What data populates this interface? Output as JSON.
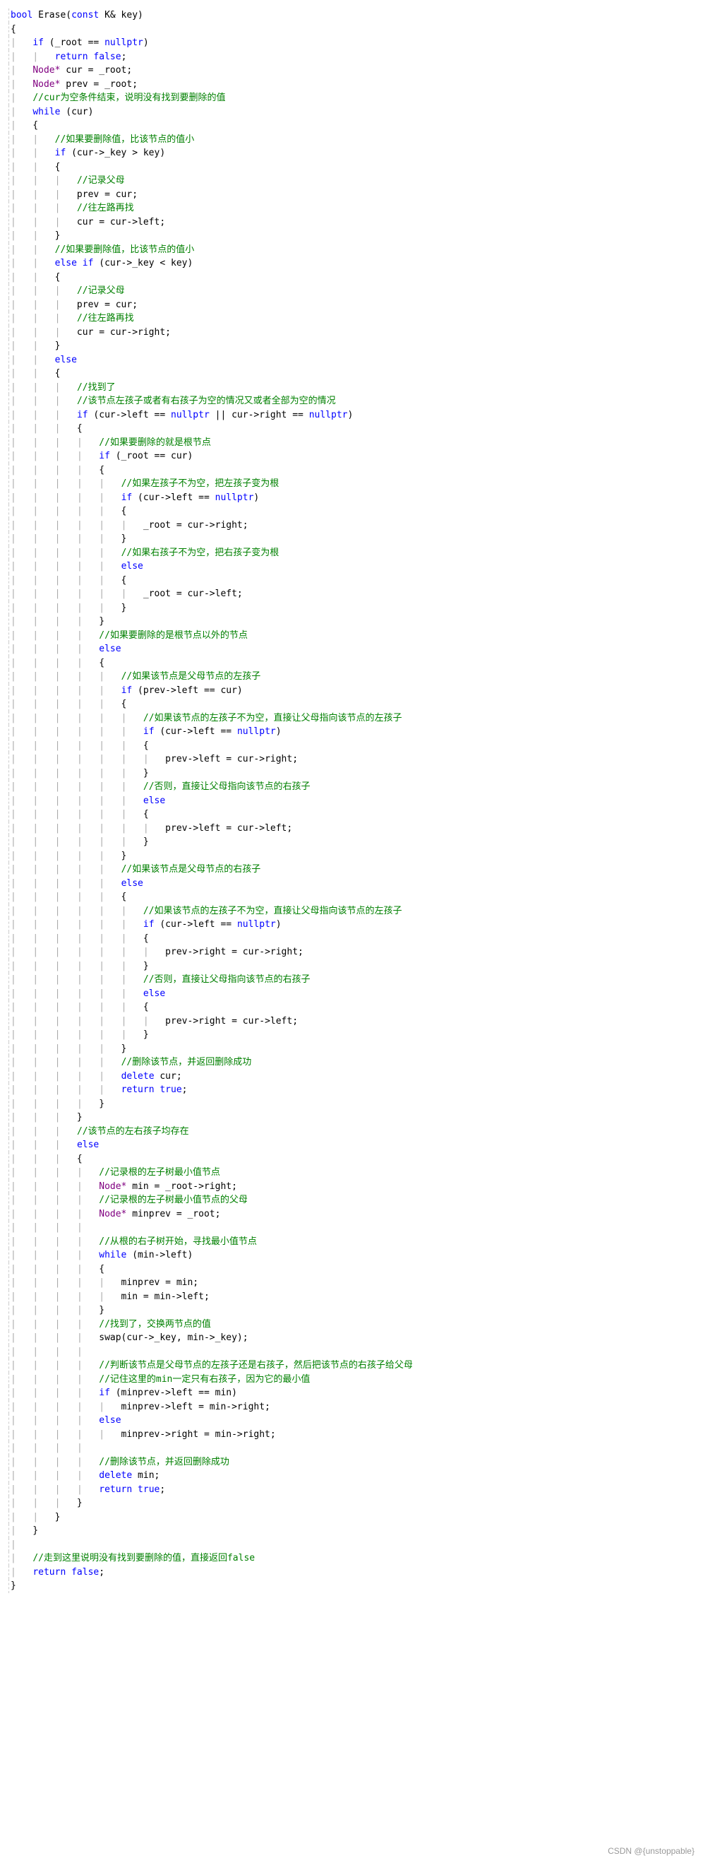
{
  "code": {
    "lines": [
      {
        "i": 0,
        "html": "<span class='k-type'>bool</span> Erase(<span class='k-type'>const</span> K& key)"
      },
      {
        "i": 0,
        "html": "{"
      },
      {
        "i": 1,
        "html": "<span class='k-key'>if</span> (_root == <span class='k-lit'>nullptr</span>)"
      },
      {
        "i": 2,
        "html": "<span class='k-key'>return</span> <span class='k-lit'>false</span>;"
      },
      {
        "i": 1,
        "html": "<span class='ptr'>Node*</span> cur = _root;"
      },
      {
        "i": 1,
        "html": "<span class='ptr'>Node*</span> prev = _root;"
      },
      {
        "i": 1,
        "html": "<span class='com'>//cur为空条件结束，说明没有找到要删除的值</span>"
      },
      {
        "i": 1,
        "html": "<span class='k-key'>while</span> (cur)"
      },
      {
        "i": 1,
        "html": "{"
      },
      {
        "i": 2,
        "html": "<span class='com'>//如果要删除值，比该节点的值小</span>"
      },
      {
        "i": 2,
        "html": "<span class='k-key'>if</span> (cur-&gt;_key &gt; key)"
      },
      {
        "i": 2,
        "html": "{"
      },
      {
        "i": 3,
        "html": "<span class='com'>//记录父母</span>"
      },
      {
        "i": 3,
        "html": "prev = cur;"
      },
      {
        "i": 3,
        "html": "<span class='com'>//往左路再找</span>"
      },
      {
        "i": 3,
        "html": "cur = cur-&gt;left;"
      },
      {
        "i": 2,
        "html": "}"
      },
      {
        "i": 2,
        "html": "<span class='com'>//如果要删除值，比该节点的值小</span>"
      },
      {
        "i": 2,
        "html": "<span class='k-key'>else</span> <span class='k-key'>if</span> (cur-&gt;_key &lt; key)"
      },
      {
        "i": 2,
        "html": "{"
      },
      {
        "i": 3,
        "html": "<span class='com'>//记录父母</span>"
      },
      {
        "i": 3,
        "html": "prev = cur;"
      },
      {
        "i": 3,
        "html": "<span class='com'>//往左路再找</span>"
      },
      {
        "i": 3,
        "html": "cur = cur-&gt;right;"
      },
      {
        "i": 2,
        "html": "}"
      },
      {
        "i": 2,
        "html": "<span class='k-key'>else</span>"
      },
      {
        "i": 2,
        "html": "{"
      },
      {
        "i": 3,
        "html": "<span class='com'>//找到了</span>"
      },
      {
        "i": 3,
        "html": "<span class='com'>//该节点左孩子或者有右孩子为空的情况又或者全部为空的情况</span>"
      },
      {
        "i": 3,
        "html": "<span class='k-key'>if</span> (cur-&gt;left == <span class='k-lit'>nullptr</span> || cur-&gt;right == <span class='k-lit'>nullptr</span>)"
      },
      {
        "i": 3,
        "html": "{"
      },
      {
        "i": 4,
        "html": "<span class='com'>//如果要删除的就是根节点</span>"
      },
      {
        "i": 4,
        "html": "<span class='k-key'>if</span> (_root == cur)"
      },
      {
        "i": 4,
        "html": "{"
      },
      {
        "i": 5,
        "html": "<span class='com'>//如果左孩子不为空，把左孩子变为根</span>"
      },
      {
        "i": 5,
        "html": "<span class='k-key'>if</span> (cur-&gt;left == <span class='k-lit'>nullptr</span>)"
      },
      {
        "i": 5,
        "html": "{"
      },
      {
        "i": 6,
        "html": "_root = cur-&gt;right;"
      },
      {
        "i": 5,
        "html": "}"
      },
      {
        "i": 5,
        "html": "<span class='com'>//如果右孩子不为空，把右孩子变为根</span>"
      },
      {
        "i": 5,
        "html": "<span class='k-key'>else</span>"
      },
      {
        "i": 5,
        "html": "{"
      },
      {
        "i": 6,
        "html": "_root = cur-&gt;left;"
      },
      {
        "i": 5,
        "html": "}"
      },
      {
        "i": 4,
        "html": "}"
      },
      {
        "i": 4,
        "html": "<span class='com'>//如果要删除的是根节点以外的节点</span>"
      },
      {
        "i": 4,
        "html": "<span class='k-key'>else</span>"
      },
      {
        "i": 4,
        "html": "{"
      },
      {
        "i": 5,
        "html": "<span class='com'>//如果该节点是父母节点的左孩子</span>"
      },
      {
        "i": 5,
        "html": "<span class='k-key'>if</span> (prev-&gt;left == cur)"
      },
      {
        "i": 5,
        "html": "{"
      },
      {
        "i": 6,
        "html": "<span class='com'>//如果该节点的左孩子不为空，直接让父母指向该节点的左孩子</span>"
      },
      {
        "i": 6,
        "html": "<span class='k-key'>if</span> (cur-&gt;left == <span class='k-lit'>nullptr</span>)"
      },
      {
        "i": 6,
        "html": "{"
      },
      {
        "i": 7,
        "html": "prev-&gt;left = cur-&gt;right;"
      },
      {
        "i": 6,
        "html": "}"
      },
      {
        "i": 6,
        "html": "<span class='com'>//否则，直接让父母指向该节点的右孩子</span>"
      },
      {
        "i": 6,
        "html": "<span class='k-key'>else</span>"
      },
      {
        "i": 6,
        "html": "{"
      },
      {
        "i": 7,
        "html": "prev-&gt;left = cur-&gt;left;"
      },
      {
        "i": 6,
        "html": "}"
      },
      {
        "i": 5,
        "html": "}"
      },
      {
        "i": 5,
        "html": "<span class='com'>//如果该节点是父母节点的右孩子</span>"
      },
      {
        "i": 5,
        "html": "<span class='k-key'>else</span>"
      },
      {
        "i": 5,
        "html": "{"
      },
      {
        "i": 6,
        "html": "<span class='com'>//如果该节点的左孩子不为空，直接让父母指向该节点的左孩子</span>"
      },
      {
        "i": 6,
        "html": "<span class='k-key'>if</span> (cur-&gt;left == <span class='k-lit'>nullptr</span>)"
      },
      {
        "i": 6,
        "html": "{"
      },
      {
        "i": 7,
        "html": "prev-&gt;right = cur-&gt;right;"
      },
      {
        "i": 6,
        "html": "}"
      },
      {
        "i": 6,
        "html": "<span class='com'>//否则，直接让父母指向该节点的右孩子</span>"
      },
      {
        "i": 6,
        "html": "<span class='k-key'>else</span>"
      },
      {
        "i": 6,
        "html": "{"
      },
      {
        "i": 7,
        "html": "prev-&gt;right = cur-&gt;left;"
      },
      {
        "i": 6,
        "html": "}"
      },
      {
        "i": 5,
        "html": "}"
      },
      {
        "i": 5,
        "html": "<span class='com'>//删除该节点，并返回删除成功</span>"
      },
      {
        "i": 5,
        "html": "<span class='k-key'>delete</span> cur;"
      },
      {
        "i": 5,
        "html": "<span class='k-key'>return</span> <span class='k-lit'>true</span>;"
      },
      {
        "i": 4,
        "html": "}"
      },
      {
        "i": 3,
        "html": "}"
      },
      {
        "i": 3,
        "html": "<span class='com'>//该节点的左右孩子均存在</span>"
      },
      {
        "i": 3,
        "html": "<span class='k-key'>else</span>"
      },
      {
        "i": 3,
        "html": "{"
      },
      {
        "i": 4,
        "html": "<span class='com'>//记录根的左子树最小值节点</span>"
      },
      {
        "i": 4,
        "html": "<span class='ptr'>Node*</span> min = _root-&gt;right;"
      },
      {
        "i": 4,
        "html": "<span class='com'>//记录根的左子树最小值节点的父母</span>"
      },
      {
        "i": 4,
        "html": "<span class='ptr'>Node*</span> minprev = _root;"
      },
      {
        "i": 4,
        "html": ""
      },
      {
        "i": 4,
        "html": "<span class='com'>//从根的右子树开始，寻找最小值节点</span>"
      },
      {
        "i": 4,
        "html": "<span class='k-key'>while</span> (min-&gt;left)"
      },
      {
        "i": 4,
        "html": "{"
      },
      {
        "i": 5,
        "html": "minprev = min;"
      },
      {
        "i": 5,
        "html": "min = min-&gt;left;"
      },
      {
        "i": 4,
        "html": "}"
      },
      {
        "i": 4,
        "html": "<span class='com'>//找到了，交换两节点的值</span>"
      },
      {
        "i": 4,
        "html": "swap(cur-&gt;_key, min-&gt;_key);"
      },
      {
        "i": 4,
        "html": ""
      },
      {
        "i": 4,
        "html": "<span class='com'>//判断该节点是父母节点的左孩子还是右孩子，然后把该节点的右孩子给父母</span>"
      },
      {
        "i": 4,
        "html": "<span class='com'>//记住这里的min一定只有右孩子，因为它的最小值</span>"
      },
      {
        "i": 4,
        "html": "<span class='k-key'>if</span> (minprev-&gt;left == min)"
      },
      {
        "i": 5,
        "html": "minprev-&gt;left = min-&gt;right;"
      },
      {
        "i": 4,
        "html": "<span class='k-key'>else</span>"
      },
      {
        "i": 5,
        "html": "minprev-&gt;right = min-&gt;right;"
      },
      {
        "i": 4,
        "html": ""
      },
      {
        "i": 4,
        "html": "<span class='com'>//删除该节点，并返回删除成功</span>"
      },
      {
        "i": 4,
        "html": "<span class='k-key'>delete</span> min;"
      },
      {
        "i": 4,
        "html": "<span class='k-key'>return</span> <span class='k-lit'>true</span>;"
      },
      {
        "i": 3,
        "html": "}"
      },
      {
        "i": 2,
        "html": "}"
      },
      {
        "i": 1,
        "html": "}"
      },
      {
        "i": 1,
        "html": ""
      },
      {
        "i": 1,
        "html": "<span class='com'>//走到这里说明没有找到要删除的值，直接返回false</span>"
      },
      {
        "i": 1,
        "html": "<span class='k-key'>return</span> <span class='k-lit'>false</span>;"
      },
      {
        "i": 0,
        "html": "}"
      }
    ]
  },
  "watermark": "CSDN @{unstoppable}"
}
